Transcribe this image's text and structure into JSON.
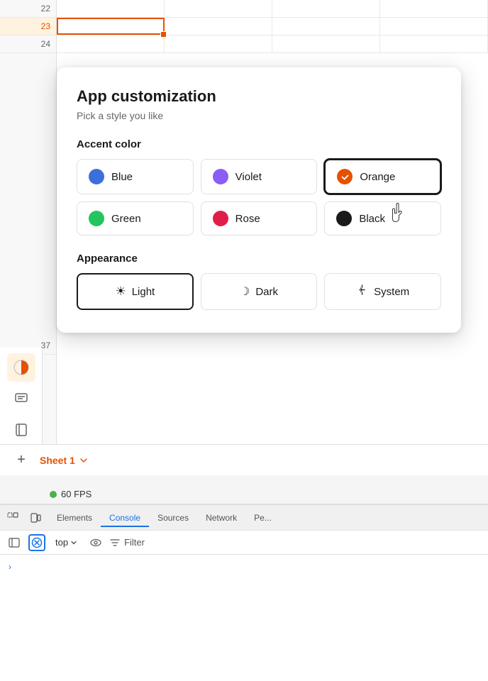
{
  "spreadsheet": {
    "rows": [
      "22",
      "23",
      "24",
      "37"
    ],
    "active_row": "23"
  },
  "sidebar": {
    "icons": [
      {
        "name": "theme-toggle-icon",
        "symbol": "◐"
      },
      {
        "name": "comment-icon",
        "symbol": "⬜"
      },
      {
        "name": "book-icon",
        "symbol": "📖"
      }
    ]
  },
  "sheet_bar": {
    "add_label": "+",
    "sheet_name": "Sheet 1",
    "dropdown_icon": "▼"
  },
  "fps": {
    "value": "60 FPS"
  },
  "popup": {
    "title": "App customization",
    "subtitle": "Pick a style you like",
    "accent_section_label": "Accent color",
    "colors": [
      {
        "id": "blue",
        "label": "Blue",
        "hex": "#3d6fdb",
        "selected": false
      },
      {
        "id": "violet",
        "label": "Violet",
        "hex": "#8b5cf6",
        "selected": false
      },
      {
        "id": "orange",
        "label": "Orange",
        "hex": "#e65100",
        "selected": true
      },
      {
        "id": "green",
        "label": "Green",
        "hex": "#22c55e",
        "selected": false
      },
      {
        "id": "rose",
        "label": "Rose",
        "hex": "#e11d48",
        "selected": false
      },
      {
        "id": "black",
        "label": "Black",
        "hex": "#1a1a1a",
        "selected": false
      }
    ],
    "appearance_section_label": "Appearance",
    "appearances": [
      {
        "id": "light",
        "label": "Light",
        "icon": "☀",
        "selected": true
      },
      {
        "id": "dark",
        "label": "Dark",
        "icon": "☽",
        "selected": false
      },
      {
        "id": "system",
        "label": "System",
        "icon": "⇅",
        "selected": false
      }
    ]
  },
  "devtools": {
    "tabs": [
      {
        "id": "elements",
        "label": "Elements",
        "active": false
      },
      {
        "id": "console",
        "label": "Console",
        "active": true
      },
      {
        "id": "sources",
        "label": "Sources",
        "active": false
      },
      {
        "id": "network",
        "label": "Network",
        "active": false
      },
      {
        "id": "performance",
        "label": "Pe...",
        "active": false
      }
    ],
    "toolbar": {
      "top_selector": "top",
      "dropdown_icon": "▼",
      "filter_label": "Filter"
    },
    "chevron_label": "›"
  }
}
